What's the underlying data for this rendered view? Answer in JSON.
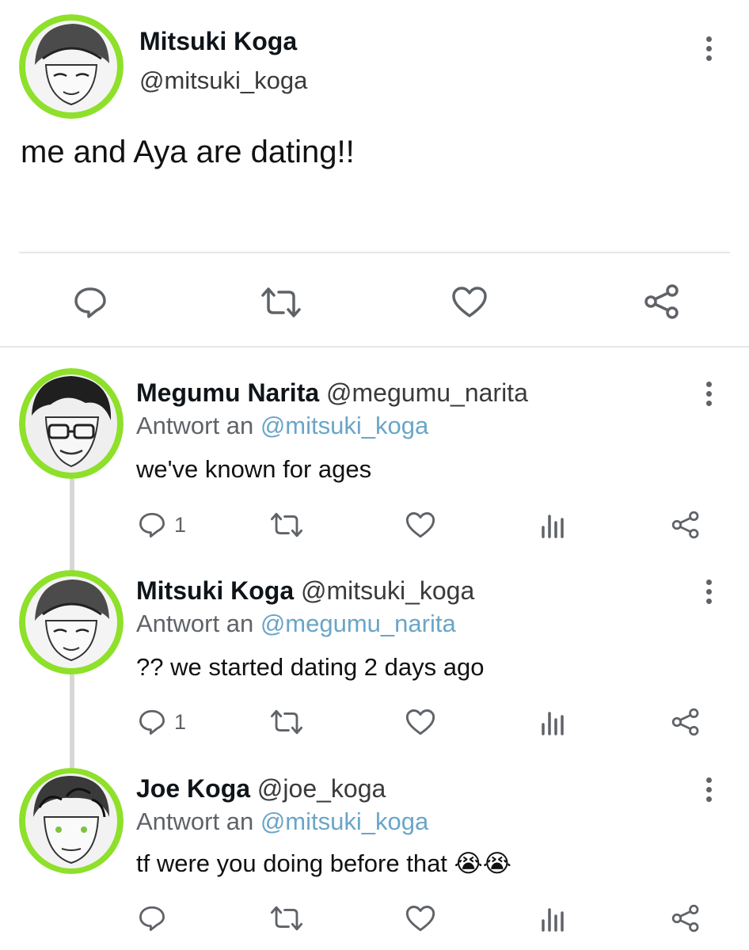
{
  "main_tweet": {
    "name": "Mitsuki Koga",
    "handle": "@mitsuki_koga",
    "text": "me and Aya are dating!!"
  },
  "reply_prefix": "Antwort an",
  "replies": [
    {
      "name": "Megumu Narita",
      "handle": "@megumu_narita",
      "reply_to": "@mitsuki_koga",
      "text": "we've known for ages",
      "reply_count": "1"
    },
    {
      "name": "Mitsuki Koga",
      "handle": "@mitsuki_koga",
      "reply_to": "@megumu_narita",
      "text": "?? we started dating 2 days ago",
      "reply_count": "1"
    },
    {
      "name": "Joe Koga",
      "handle": "@joe_koga",
      "reply_to": "@mitsuki_koga",
      "text": "tf were you doing before that",
      "emoji": "😭😭",
      "reply_count": ""
    }
  ],
  "colors": {
    "icon_gray": "#5f6368",
    "mention_blue": "#6aa5c8",
    "avatar_green": "#8ee02a"
  },
  "icons": [
    "comment-icon",
    "retweet-icon",
    "heart-icon",
    "share-icon",
    "views-icon",
    "more-icon"
  ]
}
